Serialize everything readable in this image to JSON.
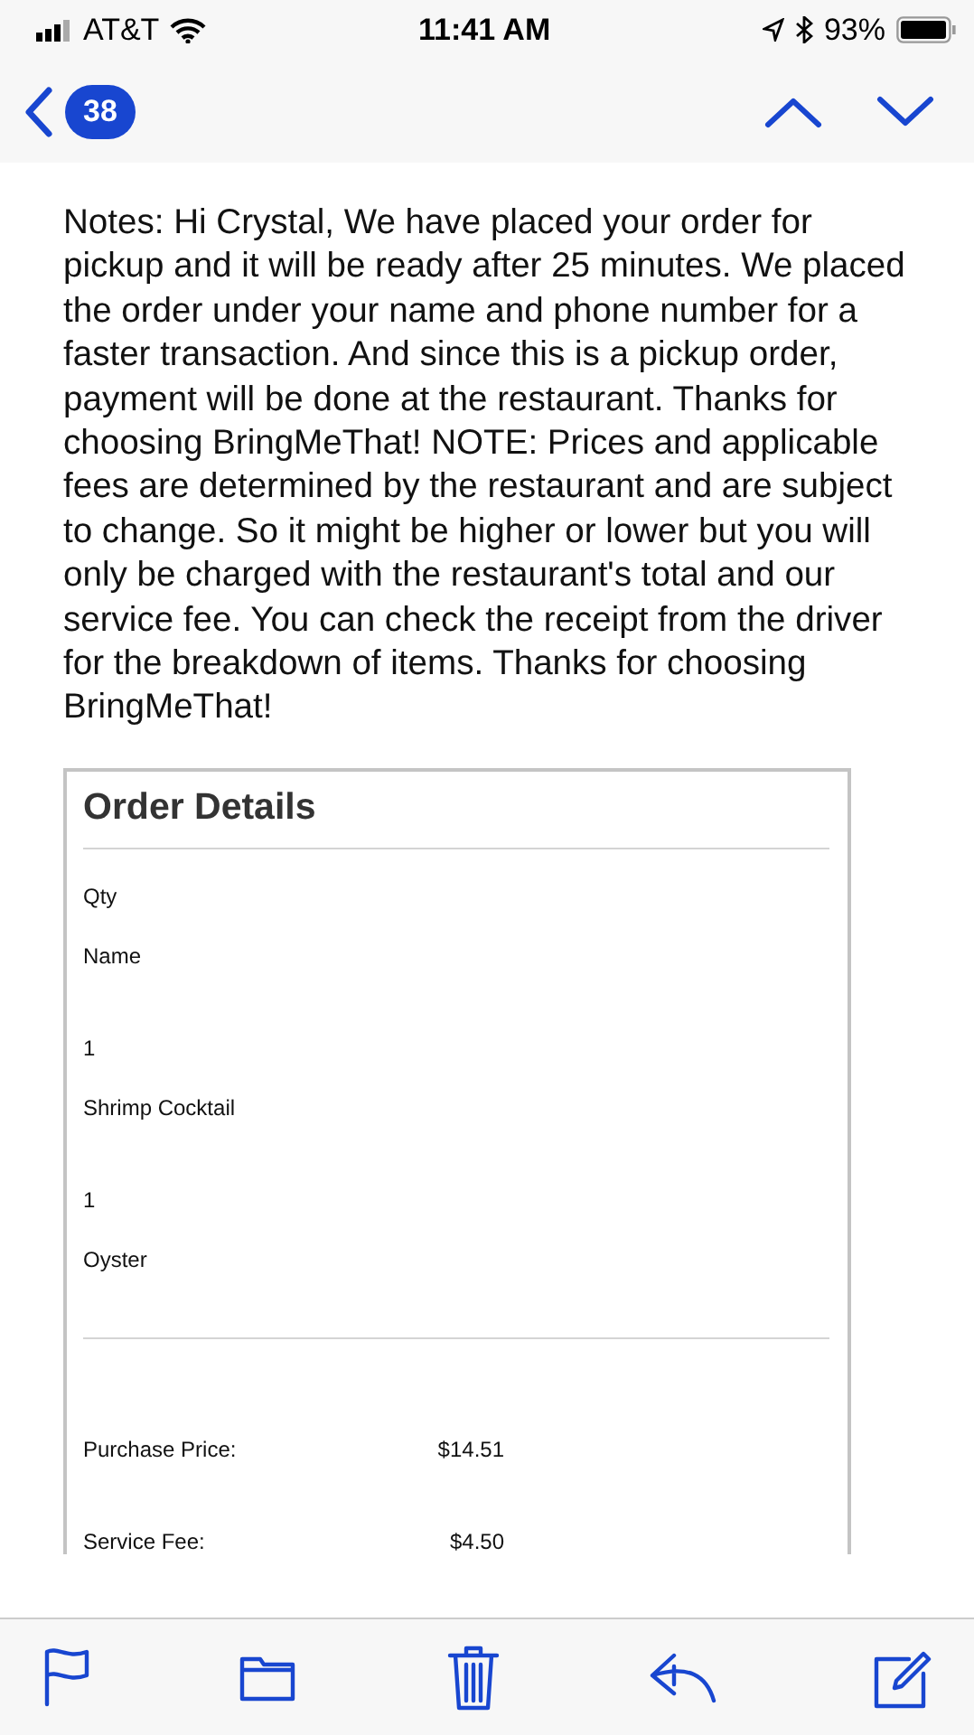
{
  "status_bar": {
    "carrier": "AT&T",
    "time": "11:41 AM",
    "battery": "93%"
  },
  "nav": {
    "unread_count": "38"
  },
  "message": {
    "notes": "Notes: Hi Crystal, We have placed your order for pickup and it will be ready after 25 minutes. We placed the order under your name and phone number for a faster transaction. And since this is a pickup order, payment will be done at the restaurant. Thanks for choosing BringMeThat! NOTE: Prices and applicable fees are determined by the restaurant and are subject to change. So it might be higher or lower but you will only be charged with the restaurant's total and our service fee. You can check the receipt from the driver for the breakdown of items. Thanks for choosing BringMeThat!"
  },
  "order": {
    "title": "Order Details",
    "columns": [
      "Qty",
      "Name"
    ],
    "items": [
      {
        "qty": "1",
        "name": "Shrimp Cocktail"
      },
      {
        "qty": "1",
        "name": "Oyster"
      }
    ],
    "totals": [
      {
        "label": "Purchase Price:",
        "amount": "$14.51"
      },
      {
        "label": "Service Fee:",
        "amount": "$4.50"
      }
    ]
  }
}
